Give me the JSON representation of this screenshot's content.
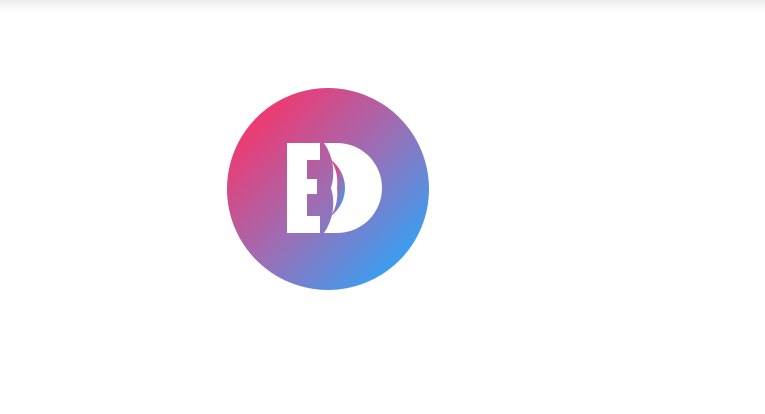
{
  "logo": {
    "label": "ED",
    "gradient_start": "#ee3a72",
    "gradient_mid": "#9a6fb6",
    "gradient_end": "#2fa3f7",
    "glyph_color": "#ffffff"
  }
}
